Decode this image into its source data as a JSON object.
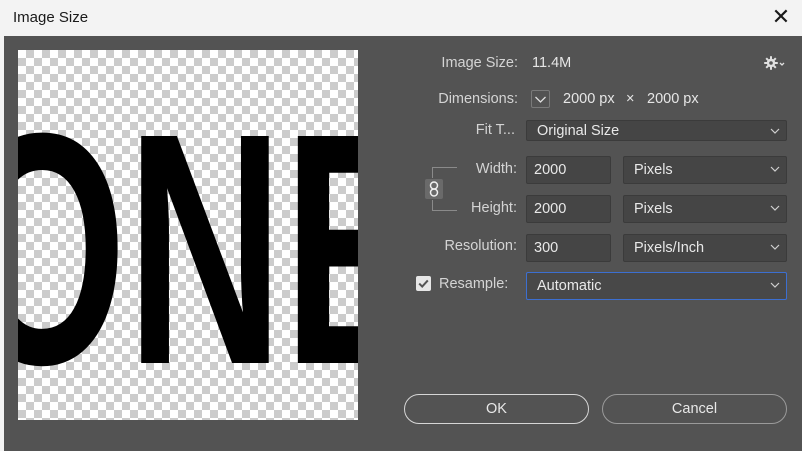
{
  "window": {
    "title": "Image Size",
    "close_glyph": "✕"
  },
  "preview": {
    "text": "ONE"
  },
  "info": {
    "image_size_label": "Image Size:",
    "image_size_value": "11.4M",
    "dimensions_label": "Dimensions:",
    "dimensions_w": "2000 px",
    "dimensions_x": "×",
    "dimensions_h": "2000 px"
  },
  "fit_to": {
    "label": "Fit T...",
    "value": "Original Size"
  },
  "width": {
    "label": "Width:",
    "value": "2000",
    "unit": "Pixels"
  },
  "height": {
    "label": "Height:",
    "value": "2000",
    "unit": "Pixels"
  },
  "resolution": {
    "label": "Resolution:",
    "value": "300",
    "unit": "Pixels/Inch"
  },
  "resample": {
    "label": "Resample:",
    "value": "Automatic",
    "checked": true
  },
  "buttons": {
    "ok": "OK",
    "cancel": "Cancel"
  },
  "colors": {
    "dialog_bg": "#535353",
    "field_bg": "#454545",
    "focus": "#3c6fd1"
  },
  "icons": [
    "close-icon",
    "gear-icon",
    "chevron-down-icon",
    "chain-link-icon",
    "checkmark-icon"
  ]
}
